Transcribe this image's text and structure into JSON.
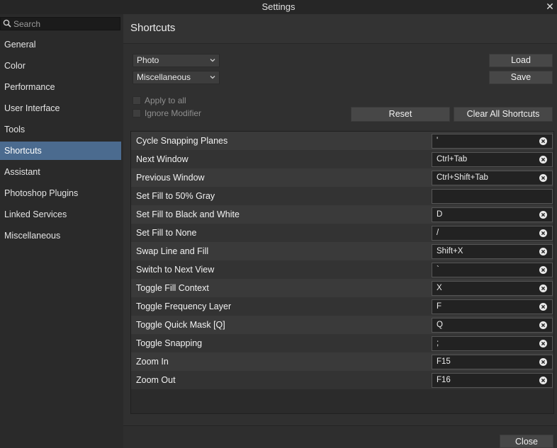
{
  "window": {
    "title": "Settings",
    "close_glyph": "✕"
  },
  "search": {
    "placeholder": "Search",
    "value": ""
  },
  "sidebar": {
    "items": [
      {
        "label": "General"
      },
      {
        "label": "Color"
      },
      {
        "label": "Performance"
      },
      {
        "label": "User Interface"
      },
      {
        "label": "Tools"
      },
      {
        "label": "Shortcuts",
        "active": true
      },
      {
        "label": "Assistant"
      },
      {
        "label": "Photoshop Plugins"
      },
      {
        "label": "Linked Services"
      },
      {
        "label": "Miscellaneous"
      }
    ]
  },
  "panel": {
    "title": "Shortcuts",
    "persona_select": "Photo",
    "category_select": "Miscellaneous",
    "load_label": "Load",
    "save_label": "Save",
    "apply_to_all_label": "Apply to all",
    "ignore_modifier_label": "Ignore Modifier",
    "reset_label": "Reset",
    "clear_all_label": "Clear All Shortcuts"
  },
  "shortcuts": [
    {
      "action": "Cycle Snapping Planes",
      "key": "'"
    },
    {
      "action": "Next Window",
      "key": "Ctrl+Tab"
    },
    {
      "action": "Previous Window",
      "key": "Ctrl+Shift+Tab"
    },
    {
      "action": "Set Fill to 50% Gray",
      "key": ""
    },
    {
      "action": "Set Fill to Black and White",
      "key": "D"
    },
    {
      "action": "Set Fill to None",
      "key": "/"
    },
    {
      "action": "Swap Line and Fill",
      "key": "Shift+X"
    },
    {
      "action": "Switch to Next View",
      "key": "`"
    },
    {
      "action": "Toggle Fill Context",
      "key": "X"
    },
    {
      "action": "Toggle Frequency Layer",
      "key": "F"
    },
    {
      "action": "Toggle Quick Mask [Q]",
      "key": "Q"
    },
    {
      "action": "Toggle Snapping",
      "key": ";"
    },
    {
      "action": "Zoom In",
      "key": "F15"
    },
    {
      "action": "Zoom Out",
      "key": "F16"
    }
  ],
  "footer": {
    "close_label": "Close"
  },
  "icons": {
    "search": "search-icon",
    "dropdown": "chevron-down-icon",
    "clear": "clear-circle-icon"
  },
  "colors": {
    "active_nav": "#4b6b8f",
    "background": "#2e2e2e"
  }
}
